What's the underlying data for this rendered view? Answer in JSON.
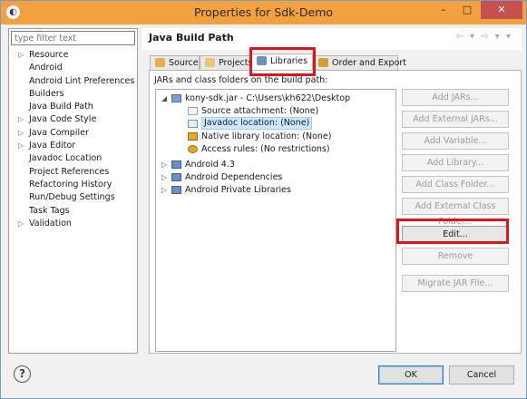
{
  "window": {
    "title": "Properties for Sdk-Demo",
    "close_icon": "✕",
    "min_icon": "–",
    "max_icon": "□"
  },
  "colors": {
    "accent": "#f3a03e",
    "highlight": "#e0141e",
    "selection": "#cce8ff"
  },
  "sidebar": {
    "filter_placeholder": "type filter text",
    "items": [
      {
        "label": "Resource",
        "expandable": true
      },
      {
        "label": "Android",
        "expandable": false
      },
      {
        "label": "Android Lint Preferences",
        "expandable": false
      },
      {
        "label": "Builders",
        "expandable": false
      },
      {
        "label": "Java Build Path",
        "expandable": false
      },
      {
        "label": "Java Code Style",
        "expandable": true
      },
      {
        "label": "Java Compiler",
        "expandable": true
      },
      {
        "label": "Java Editor",
        "expandable": true
      },
      {
        "label": "Javadoc Location",
        "expandable": false
      },
      {
        "label": "Project References",
        "expandable": false
      },
      {
        "label": "Refactoring History",
        "expandable": false
      },
      {
        "label": "Run/Debug Settings",
        "expandable": false
      },
      {
        "label": "Task Tags",
        "expandable": false
      },
      {
        "label": "Validation",
        "expandable": true
      }
    ]
  },
  "page": {
    "title": "Java Build Path",
    "nav": "⇦ ▾ ⇨ ▾ ▾"
  },
  "tabs": [
    "Source",
    "Projects",
    "Libraries",
    "Order and Export"
  ],
  "panel": {
    "label": "JARs and class folders on the build path:",
    "tree": [
      {
        "label": "kony-sdk.jar - C:\\Users\\kh622\\Desktop",
        "twisty": "◢"
      },
      {
        "label": "Source attachment: (None)"
      },
      {
        "label": "Javadoc location: (None)"
      },
      {
        "label": "Native library location: (None)"
      },
      {
        "label": "Access rules: (No restrictions)"
      },
      {
        "label": "Android 4.3",
        "twisty": "▷"
      },
      {
        "label": "Android Dependencies",
        "twisty": "▷"
      },
      {
        "label": "Android Private Libraries",
        "twisty": "▷"
      }
    ],
    "buttons": {
      "add_jars": "Add JARs...",
      "add_external_jars": "Add External JARs...",
      "add_variable": "Add Variable...",
      "add_library": "Add Library...",
      "add_class_folder": "Add Class Folder...",
      "add_external_class_folder": "Add External Class Folder...",
      "edit": "Edit...",
      "remove": "Remove",
      "migrate": "Migrate JAR File..."
    }
  },
  "footer": {
    "help": "?",
    "ok": "OK",
    "cancel": "Cancel"
  }
}
